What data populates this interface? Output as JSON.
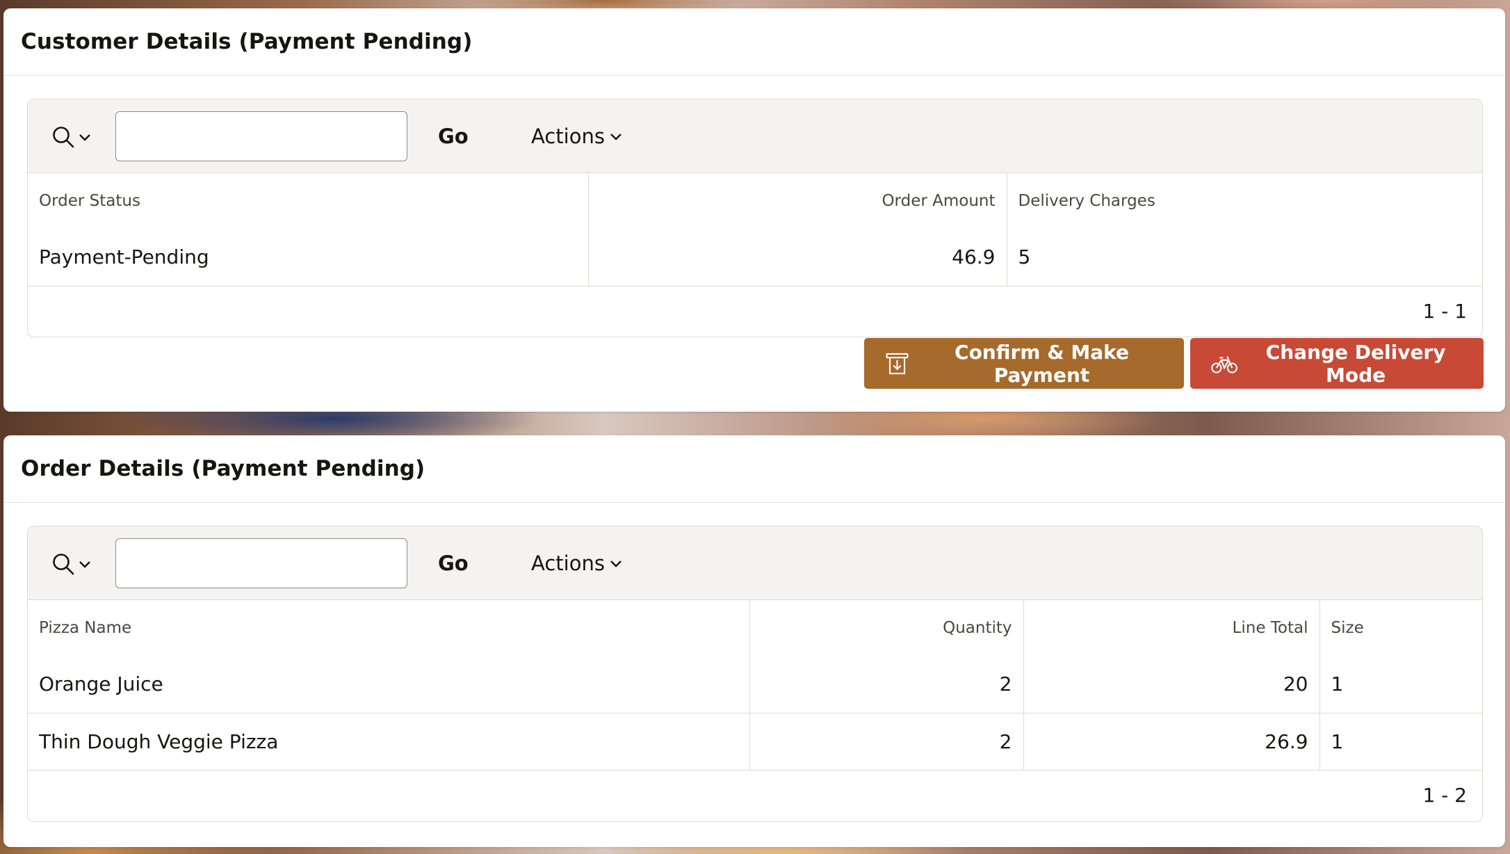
{
  "customer_panel": {
    "title": "Customer Details (Payment Pending)",
    "toolbar": {
      "search_icon": "search-icon",
      "search_value": "",
      "go_label": "Go",
      "actions_label": "Actions"
    },
    "columns": [
      "Order Status",
      "Order Amount",
      "Delivery Charges"
    ],
    "rows": [
      {
        "order_status": "Payment-Pending",
        "order_amount": "46.9",
        "delivery_charges": "5"
      }
    ],
    "pagination": "1 - 1",
    "buttons": {
      "confirm_payment": "Confirm & Make Payment",
      "change_delivery": "Change Delivery Mode"
    }
  },
  "order_panel": {
    "title": "Order Details (Payment Pending)",
    "toolbar": {
      "search_icon": "search-icon",
      "search_value": "",
      "go_label": "Go",
      "actions_label": "Actions"
    },
    "columns": [
      "Pizza Name",
      "Quantity",
      "Line Total",
      "Size"
    ],
    "rows": [
      {
        "pizza_name": "Orange Juice",
        "quantity": "2",
        "line_total": "20",
        "size": "1"
      },
      {
        "pizza_name": "Thin Dough Veggie Pizza",
        "quantity": "2",
        "line_total": "26.9",
        "size": "1"
      }
    ],
    "pagination": "1 - 2"
  },
  "colors": {
    "payment_button": "#a66a2c",
    "delivery_button": "#c84a36"
  }
}
